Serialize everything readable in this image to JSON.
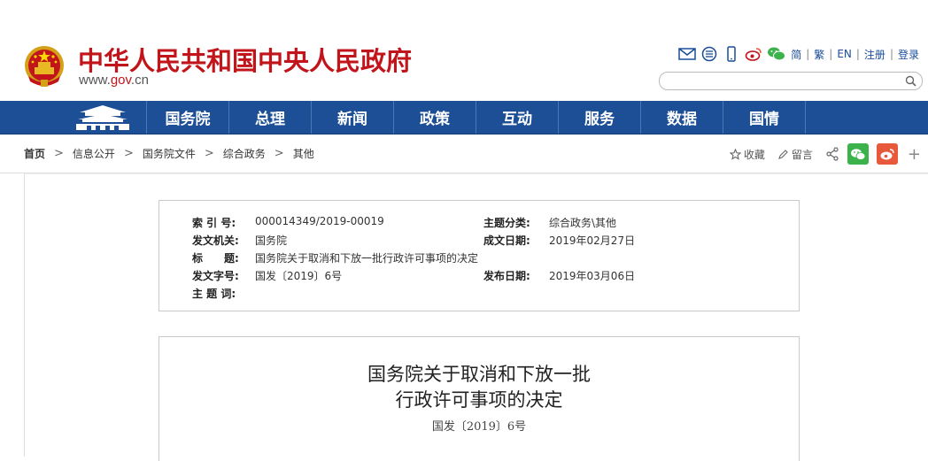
{
  "header": {
    "site_title": "中华人民共和国中央人民政府",
    "url_prefix": "www.",
    "url_domain": "gov",
    "url_suffix": ".cn",
    "tools": [
      "mail-icon",
      "rss-icon",
      "mobile-icon",
      "weibo-icon",
      "wechat-icon"
    ],
    "lang_simplified": "简",
    "lang_traditional": "繁",
    "lang_english": "EN",
    "register": "注册",
    "login": "登录",
    "search_placeholder": ""
  },
  "nav": {
    "items": [
      "国务院",
      "总理",
      "新闻",
      "政策",
      "互动",
      "服务",
      "数据",
      "国情"
    ]
  },
  "breadcrumb": {
    "items": [
      "首页",
      "信息公开",
      "国务院文件",
      "综合政务",
      "其他"
    ]
  },
  "actions": {
    "favorite": "收藏",
    "comment": "留言"
  },
  "meta": {
    "index_label": "索 引 号:",
    "index_value": "000014349/2019-00019",
    "topic_label": "主题分类:",
    "topic_value": "综合政务\\其他",
    "issuer_label": "发文机关:",
    "issuer_value": "国务院",
    "date_label": "成文日期:",
    "date_value": "2019年02月27日",
    "title_label": "标　　题:",
    "title_value": "国务院关于取消和下放一批行政许可事项的决定",
    "docno_label": "发文字号:",
    "docno_value": "国发〔2019〕6号",
    "pub_label": "发布日期:",
    "pub_value": "2019年03月06日",
    "keywords_label": "主 题 词:",
    "keywords_value": ""
  },
  "document": {
    "title_line1": "国务院关于取消和下放一批",
    "title_line2": "行政许可事项的决定",
    "number": "国发〔2019〕6号"
  },
  "colors": {
    "brand_red": "#c2141b",
    "nav_blue": "#1c4f96",
    "link_blue": "#1a4d99",
    "wechat_green": "#3bb34a",
    "weibo_orange": "#e8593b"
  }
}
